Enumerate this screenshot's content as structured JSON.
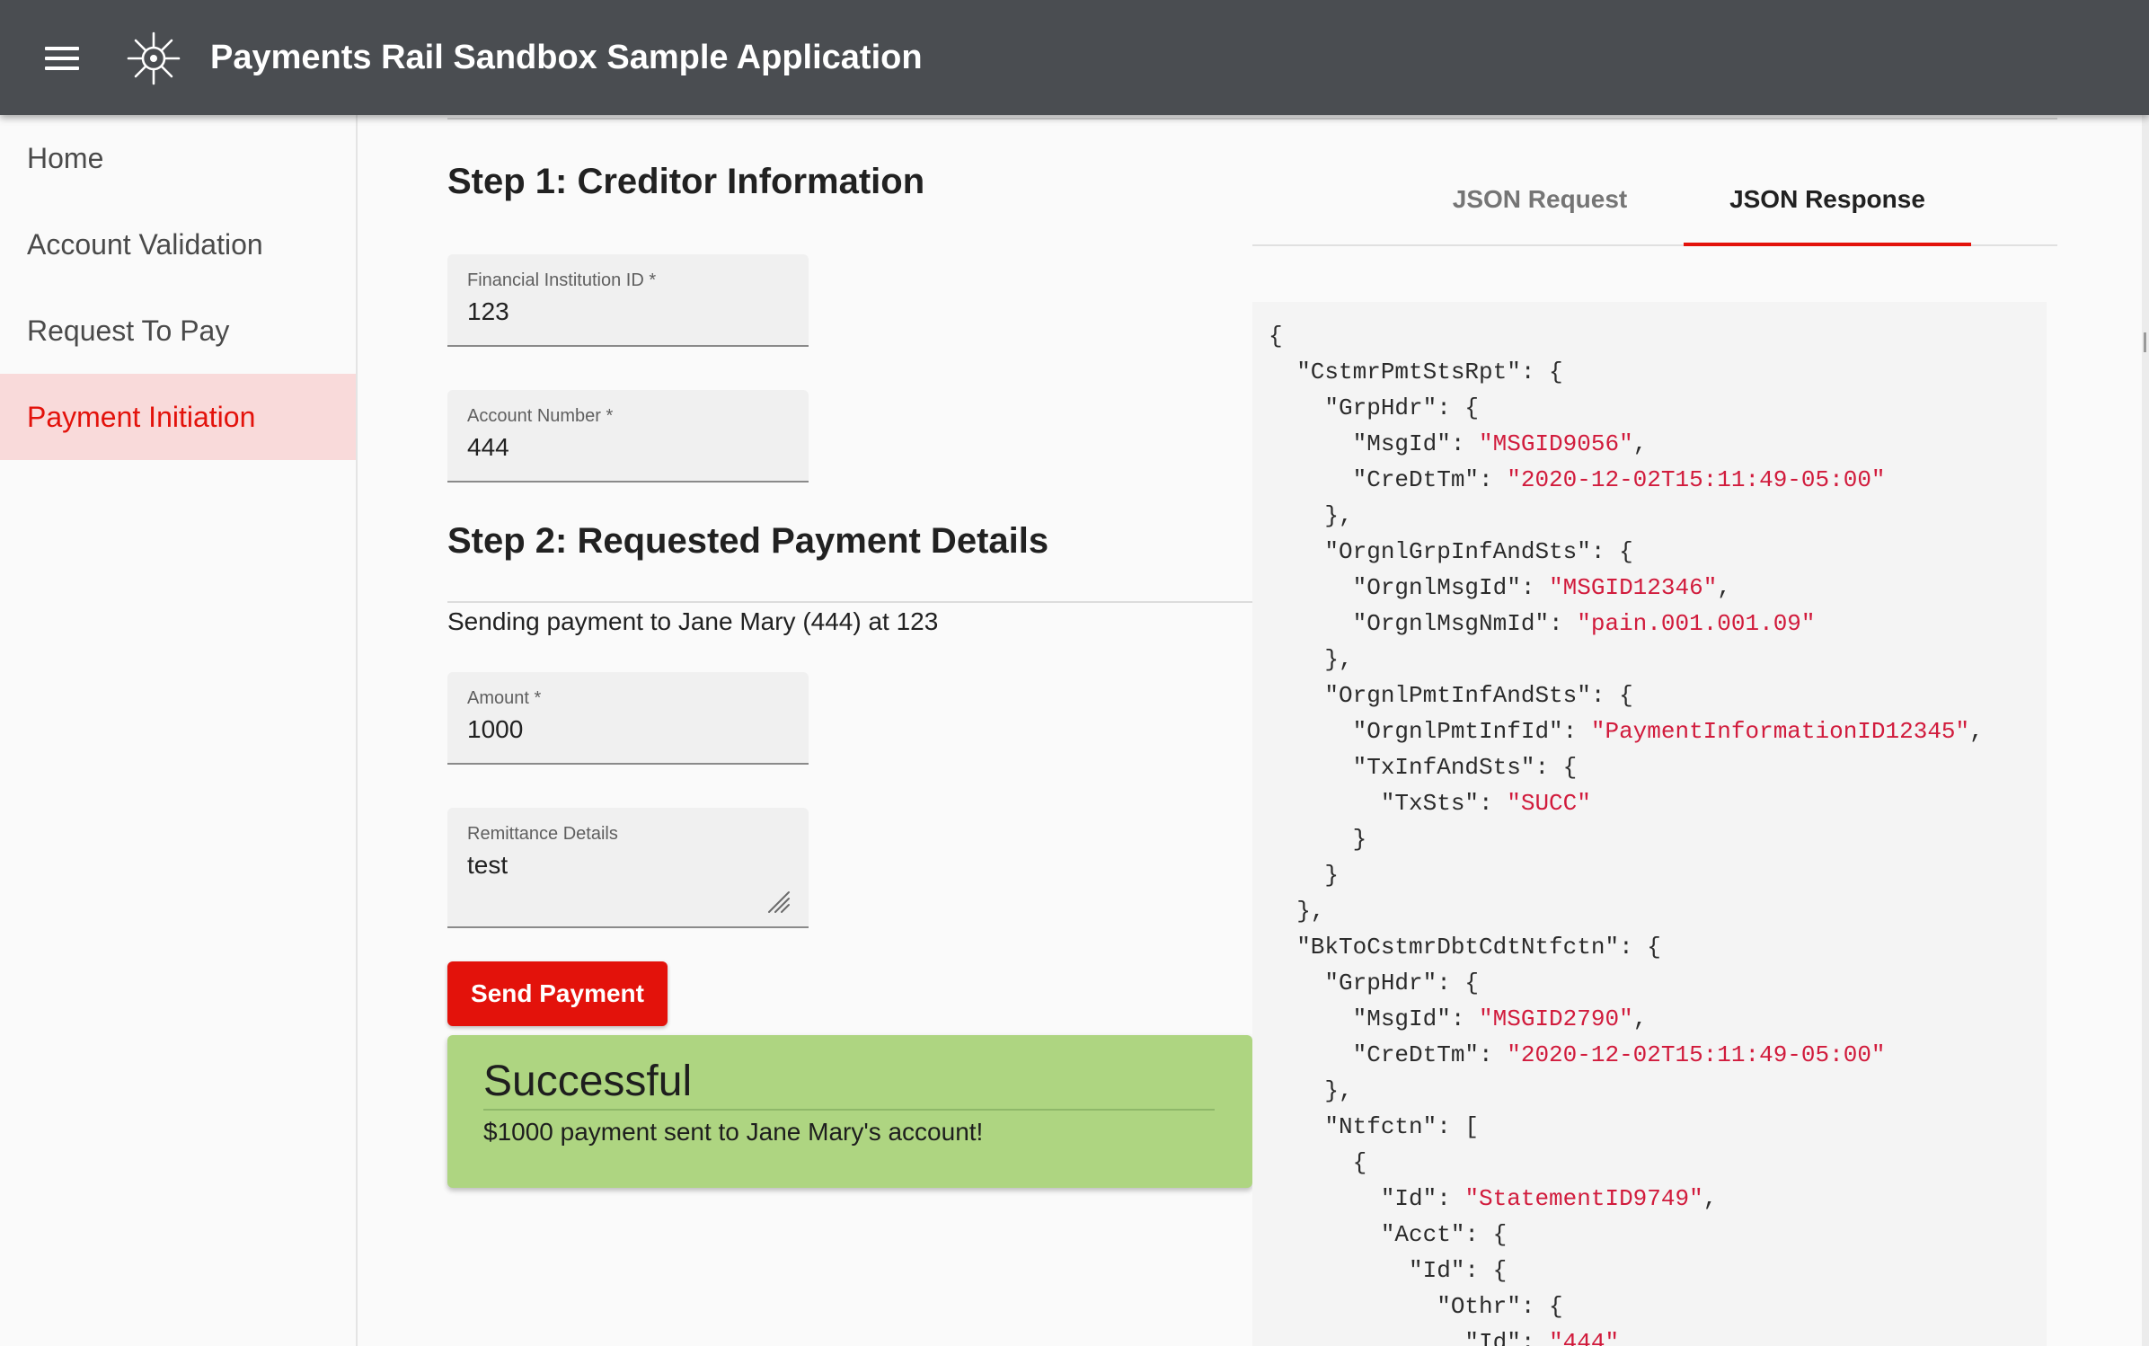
{
  "app": {
    "title": "Payments Rail Sandbox Sample Application",
    "menu_icon": "hamburger-menu-icon",
    "logo_icon": "starburst-logo-icon"
  },
  "sidebar": {
    "items": [
      {
        "label": "Home",
        "active": false
      },
      {
        "label": "Account Validation",
        "active": false
      },
      {
        "label": "Request To Pay",
        "active": false
      },
      {
        "label": "Payment Initiation",
        "active": true
      }
    ]
  },
  "step1": {
    "title": "Step 1: Creditor Information",
    "institution": {
      "label": "Financial Institution ID *",
      "value": "123"
    },
    "account": {
      "label": "Account Number *",
      "value": "444"
    }
  },
  "step2": {
    "title": "Step 2: Requested Payment Details",
    "sending_text": "Sending payment to Jane Mary (444) at 123",
    "amount": {
      "label": "Amount *",
      "value": "1000"
    },
    "remittance": {
      "label": "Remittance Details",
      "value": "test"
    },
    "send_button": "Send Payment"
  },
  "success": {
    "title": "Successful",
    "message": "$1000 payment sent to Jane Mary's account!"
  },
  "tabs": [
    {
      "label": "JSON Request",
      "active": false
    },
    {
      "label": "JSON Response",
      "active": true
    }
  ],
  "json_lines": [
    {
      "pre": "{",
      "val": "",
      "post": ""
    },
    {
      "pre": "  \"CstmrPmtStsRpt\": {",
      "val": "",
      "post": ""
    },
    {
      "pre": "    \"GrpHdr\": {",
      "val": "",
      "post": ""
    },
    {
      "pre": "      \"MsgId\": ",
      "val": "\"MSGID9056\"",
      "post": ","
    },
    {
      "pre": "      \"CreDtTm\": ",
      "val": "\"2020-12-02T15:11:49-05:00\"",
      "post": ""
    },
    {
      "pre": "    },",
      "val": "",
      "post": ""
    },
    {
      "pre": "    \"OrgnlGrpInfAndSts\": {",
      "val": "",
      "post": ""
    },
    {
      "pre": "      \"OrgnlMsgId\": ",
      "val": "\"MSGID12346\"",
      "post": ","
    },
    {
      "pre": "      \"OrgnlMsgNmId\": ",
      "val": "\"pain.001.001.09\"",
      "post": ""
    },
    {
      "pre": "    },",
      "val": "",
      "post": ""
    },
    {
      "pre": "    \"OrgnlPmtInfAndSts\": {",
      "val": "",
      "post": ""
    },
    {
      "pre": "      \"OrgnlPmtInfId\": ",
      "val": "\"PaymentInformationID12345\"",
      "post": ","
    },
    {
      "pre": "      \"TxInfAndSts\": {",
      "val": "",
      "post": ""
    },
    {
      "pre": "        \"TxSts\": ",
      "val": "\"SUCC\"",
      "post": ""
    },
    {
      "pre": "      }",
      "val": "",
      "post": ""
    },
    {
      "pre": "    }",
      "val": "",
      "post": ""
    },
    {
      "pre": "  },",
      "val": "",
      "post": ""
    },
    {
      "pre": "  \"BkToCstmrDbtCdtNtfctn\": {",
      "val": "",
      "post": ""
    },
    {
      "pre": "    \"GrpHdr\": {",
      "val": "",
      "post": ""
    },
    {
      "pre": "      \"MsgId\": ",
      "val": "\"MSGID2790\"",
      "post": ","
    },
    {
      "pre": "      \"CreDtTm\": ",
      "val": "\"2020-12-02T15:11:49-05:00\"",
      "post": ""
    },
    {
      "pre": "    },",
      "val": "",
      "post": ""
    },
    {
      "pre": "    \"Ntfctn\": [",
      "val": "",
      "post": ""
    },
    {
      "pre": "      {",
      "val": "",
      "post": ""
    },
    {
      "pre": "        \"Id\": ",
      "val": "\"StatementID9749\"",
      "post": ","
    },
    {
      "pre": "        \"Acct\": {",
      "val": "",
      "post": ""
    },
    {
      "pre": "          \"Id\": {",
      "val": "",
      "post": ""
    },
    {
      "pre": "            \"Othr\": {",
      "val": "",
      "post": ""
    },
    {
      "pre": "              \"Id\": ",
      "val": "\"444\"",
      "post": ""
    }
  ],
  "colors": {
    "appbar": "#4a4d51",
    "accent": "#e3120b",
    "active_nav_bg": "#f9dada",
    "success_bg": "#aed581",
    "json_string": "#d11b3c"
  }
}
